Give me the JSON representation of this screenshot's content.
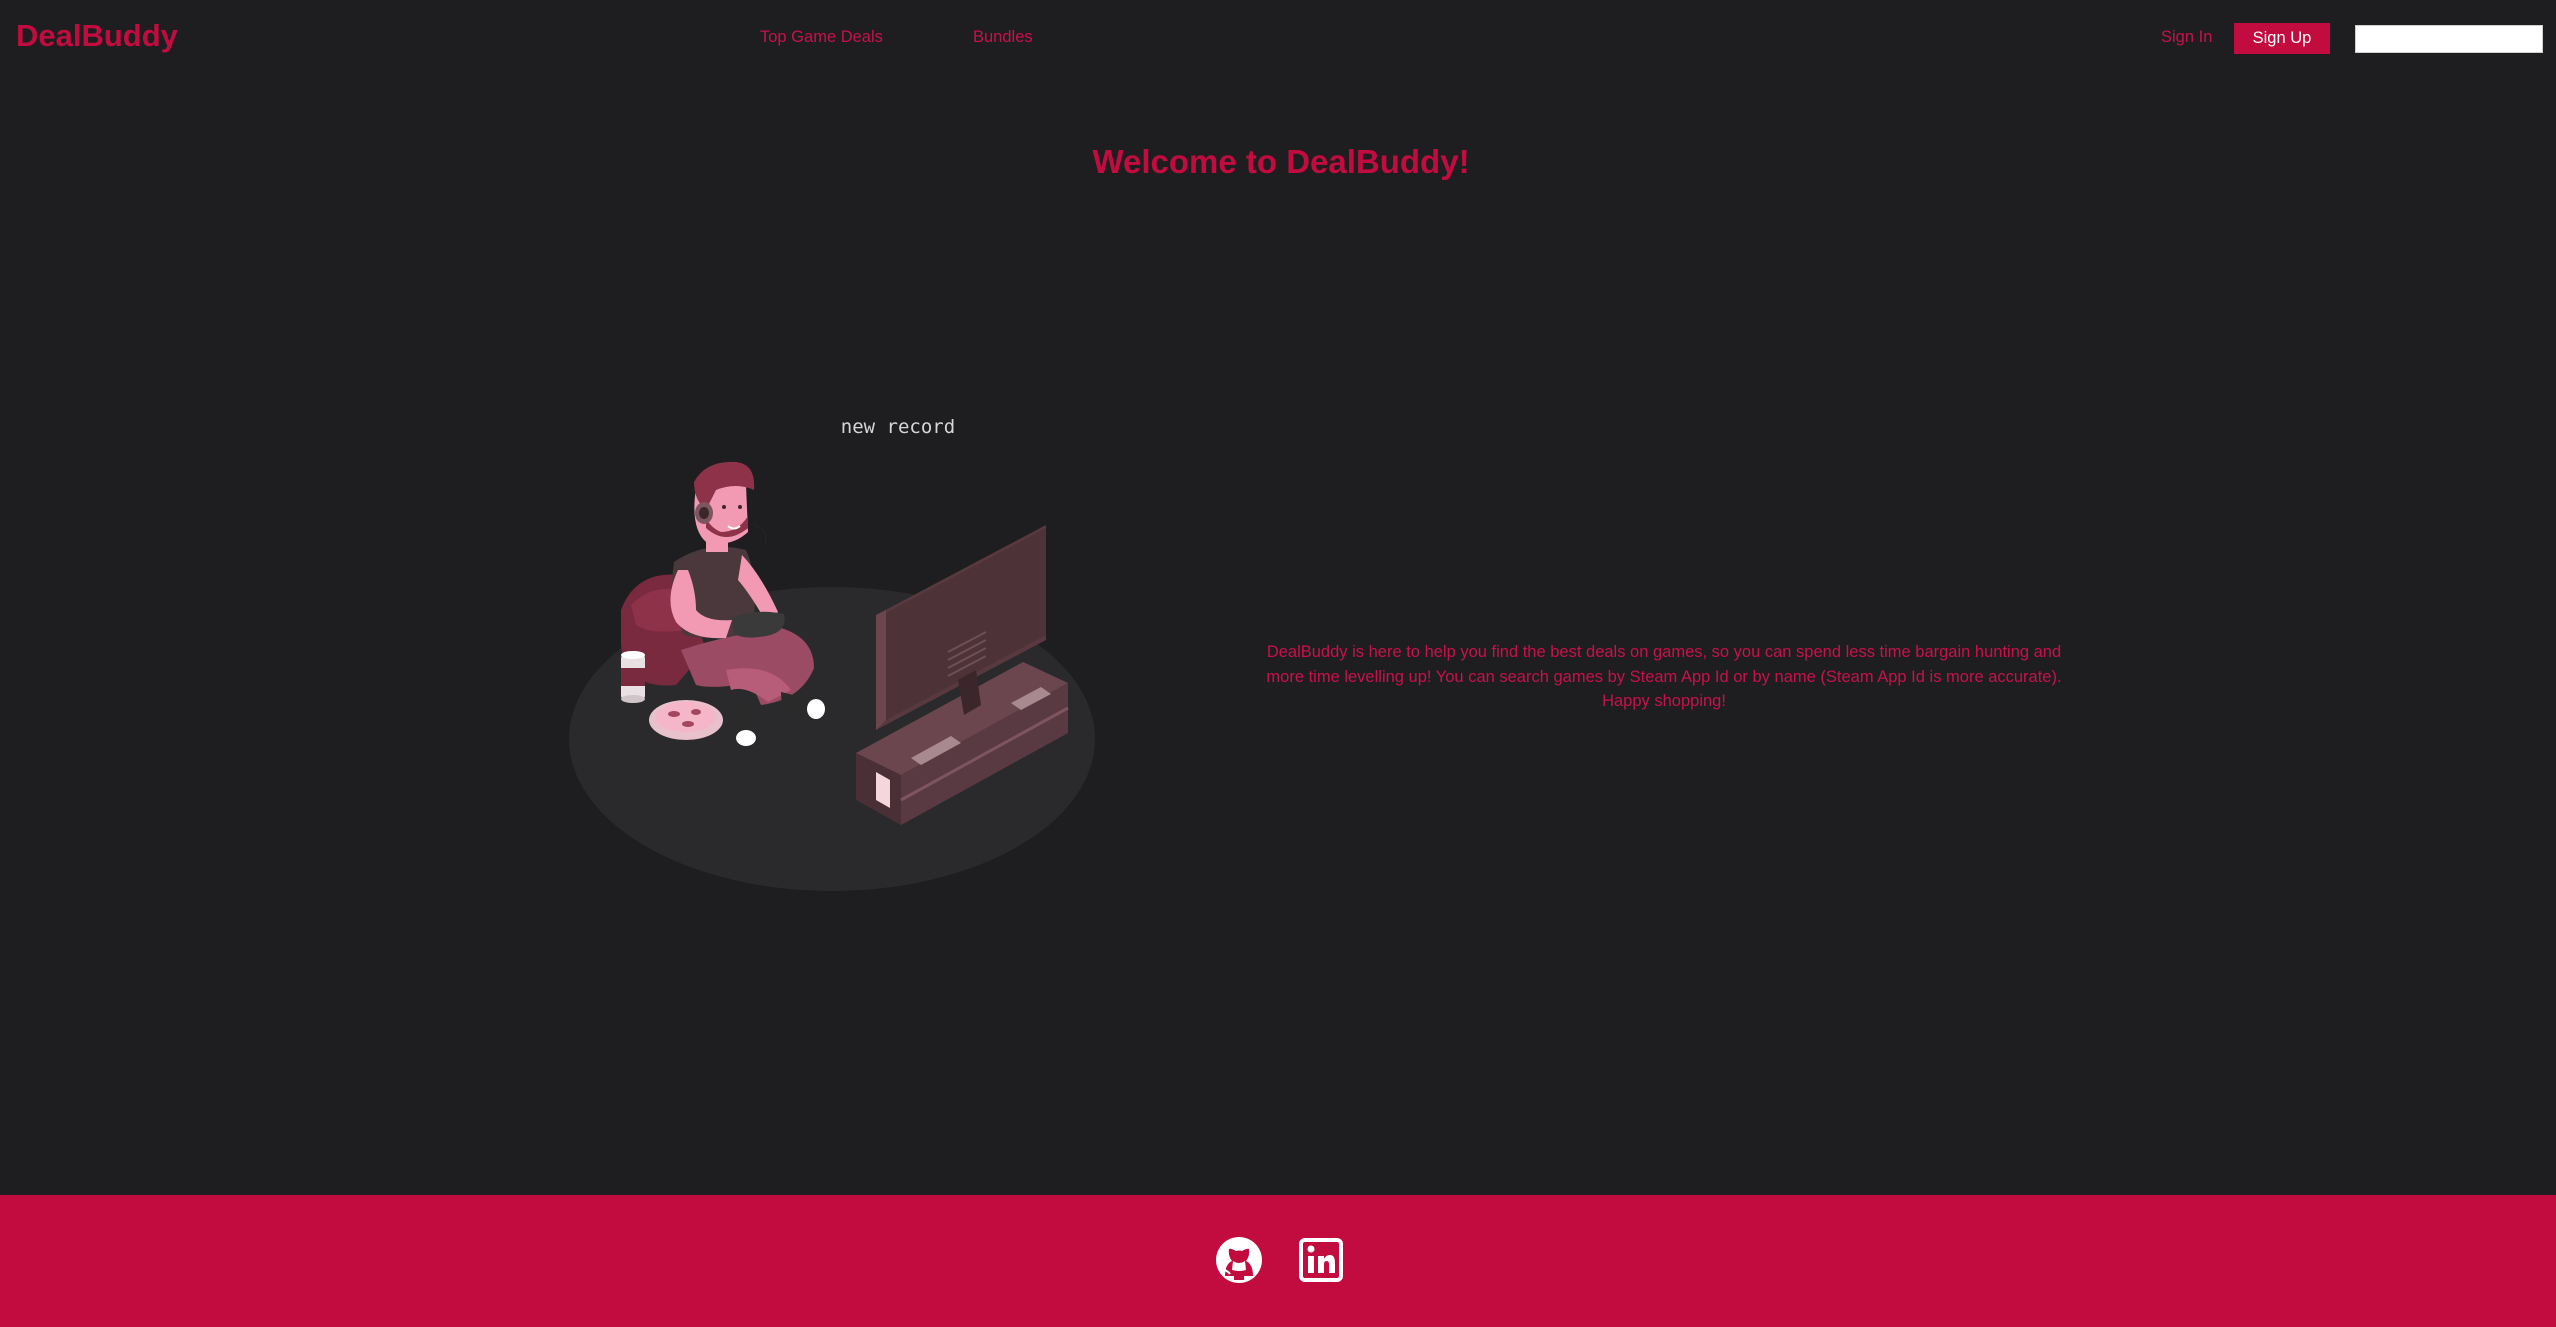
{
  "header": {
    "brand": "DealBuddy",
    "nav": [
      {
        "label": "Top Game Deals"
      },
      {
        "label": "Bundles"
      }
    ],
    "sign_in": "Sign In",
    "sign_up": "Sign Up",
    "search": {
      "value": "",
      "placeholder": ""
    }
  },
  "main": {
    "title": "Welcome to DealBuddy!",
    "illustration": {
      "caption": "new record",
      "icon": "gamer-illustration"
    },
    "description": "DealBuddy is here to help you find the best deals on games, so you can spend less time bargain hunting and more time levelling up! You can search games by Steam App Id or by name (Steam App Id is more accurate). Happy shopping!"
  },
  "footer": {
    "links": [
      {
        "icon": "github-icon"
      },
      {
        "icon": "linkedin-icon"
      }
    ]
  },
  "colors": {
    "background": "#1e1e20",
    "accent": "#c20b3f",
    "text_accent": "#c7124a",
    "input_bg": "#ffffff"
  }
}
